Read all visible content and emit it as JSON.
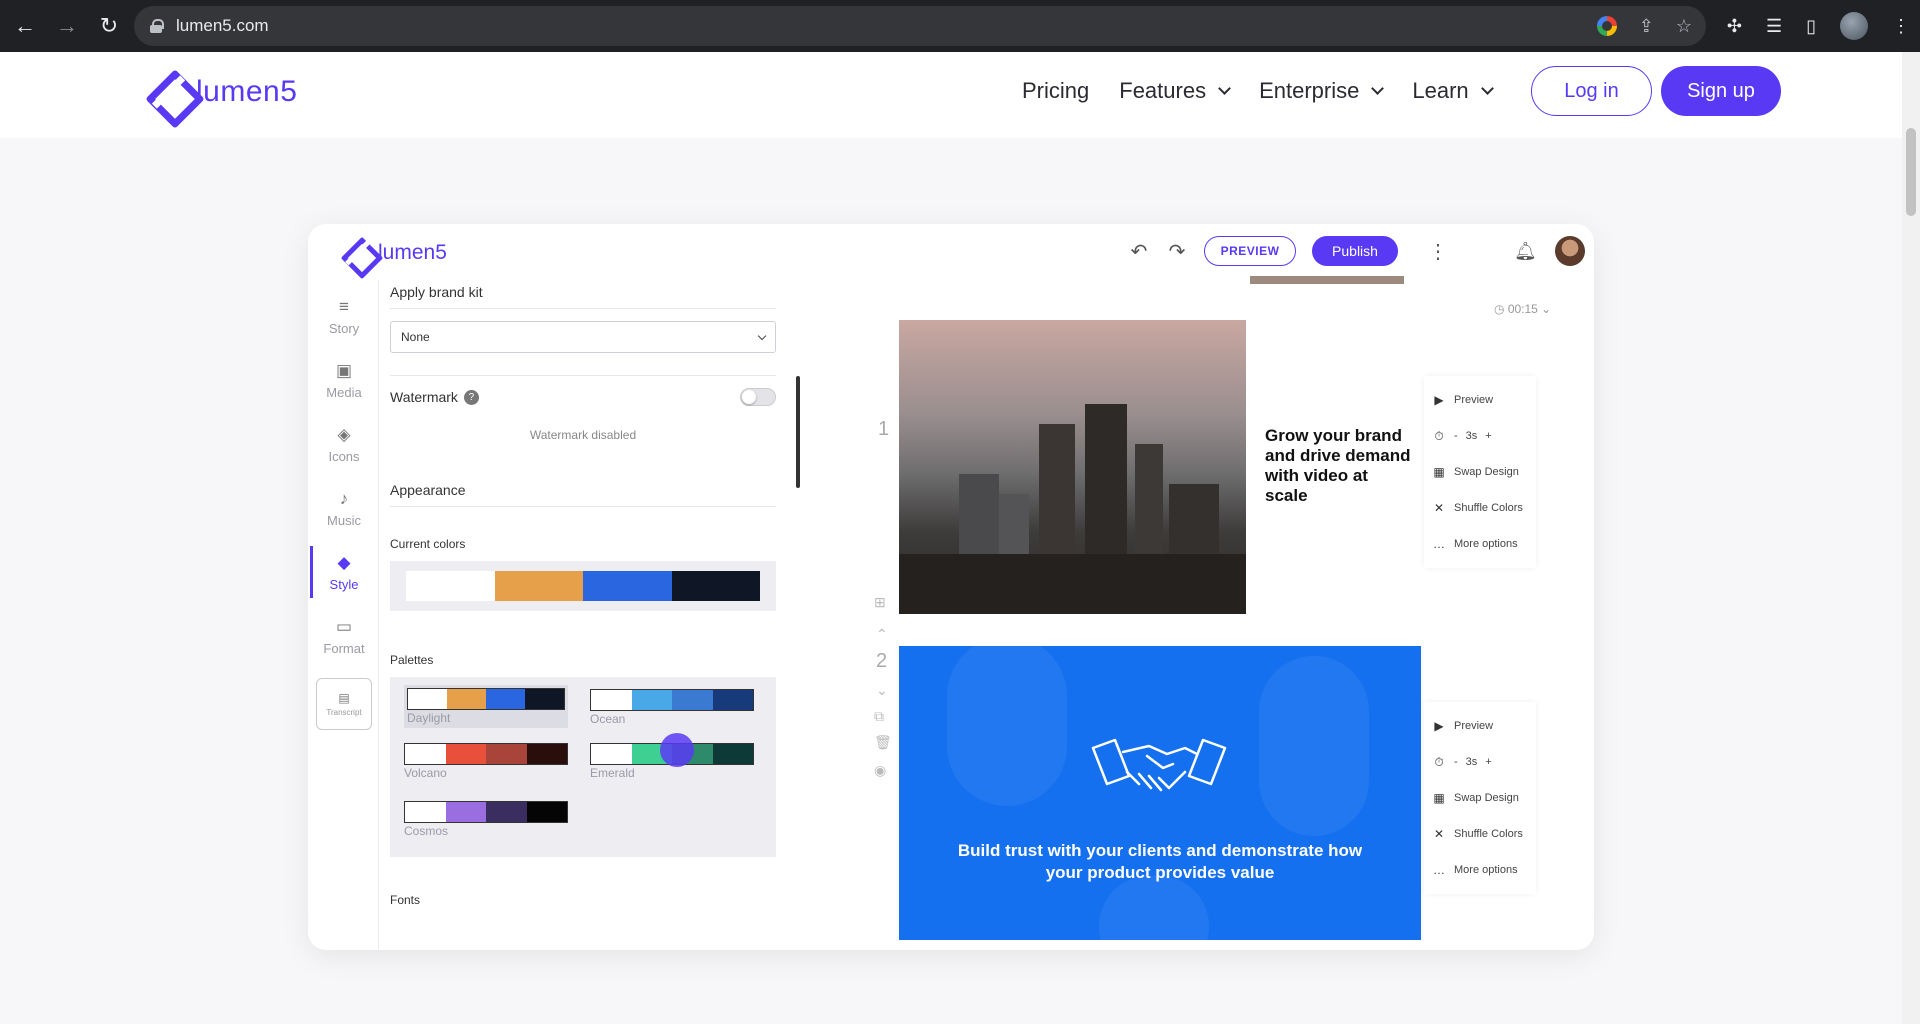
{
  "browser": {
    "url": "lumen5.com",
    "back": "←",
    "forward": "→",
    "reload": "↻"
  },
  "site": {
    "logo_text": "lumen5",
    "nav": [
      "Pricing",
      "Features",
      "Enterprise",
      "Learn"
    ],
    "login": "Log in",
    "signup": "Sign up"
  },
  "app": {
    "logo_text": "lumen5",
    "preview_btn": "PREVIEW",
    "publish_btn": "Publish",
    "rail": [
      {
        "label": "Story",
        "icon": "≡"
      },
      {
        "label": "Media",
        "icon": "▣"
      },
      {
        "label": "Icons",
        "icon": "◈"
      },
      {
        "label": "Music",
        "icon": "♪"
      },
      {
        "label": "Style",
        "icon": "◆"
      },
      {
        "label": "Format",
        "icon": "▭"
      }
    ],
    "transcript": "Transcript",
    "panel": {
      "brand_kit": "Apply brand kit",
      "brand_select": "None",
      "watermark": "Watermark",
      "watermark_note": "Watermark disabled",
      "appearance": "Appearance",
      "current_colors": "Current colors",
      "palettes": "Palettes",
      "fonts": "Fonts"
    },
    "current_colors": [
      "#ffffff",
      "#e6a04a",
      "#2a66e0",
      "#0f1626"
    ],
    "palette_list": [
      {
        "name": "Daylight",
        "colors": [
          "#ffffff",
          "#e6a04a",
          "#2a66e0",
          "#0f1626"
        ]
      },
      {
        "name": "Ocean",
        "colors": [
          "#ffffff",
          "#48a9e6",
          "#3a7ad0",
          "#163a7a"
        ]
      },
      {
        "name": "Volcano",
        "colors": [
          "#ffffff",
          "#e8503c",
          "#a8443a",
          "#2a0e0c"
        ]
      },
      {
        "name": "Emerald",
        "colors": [
          "#ffffff",
          "#3ecf92",
          "#2d8a6a",
          "#0d3a36"
        ]
      },
      {
        "name": "Cosmos",
        "colors": [
          "#ffffff",
          "#9a6ee0",
          "#3a2e60",
          "#050506"
        ]
      }
    ],
    "time": "00:15",
    "slides": [
      {
        "number": "1",
        "caption": "Grow your brand and drive demand with video at scale"
      },
      {
        "number": "2",
        "caption": "Build trust with your clients and demonstrate how your product provides value"
      }
    ],
    "tools": {
      "preview": "Preview",
      "minus": "-",
      "duration": "3s",
      "plus": "+",
      "swap": "Swap Design",
      "shuffle": "Shuffle Colors",
      "more": "More options"
    }
  }
}
